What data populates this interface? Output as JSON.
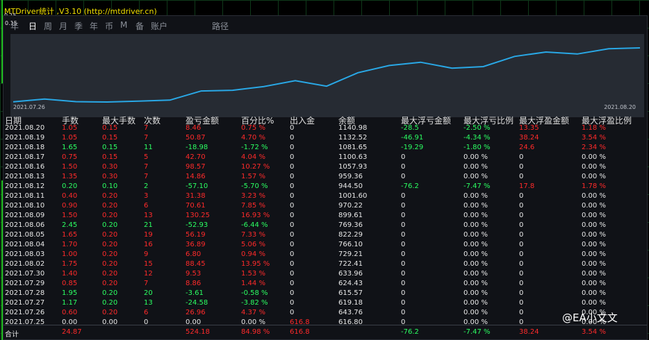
{
  "title": "MTDriver统计 ,V3.10 (http://mtdriver.cn)",
  "price_top": "0.15",
  "price_low": "0.15",
  "tabs": [
    "年",
    "日",
    "周",
    "月",
    "季",
    "年",
    "币",
    "M",
    "备",
    "账户",
    "路径"
  ],
  "active_tab": 1,
  "chart_data": {
    "type": "line",
    "x_start": "2021.07.26",
    "x_end": "2021.08.20",
    "x": [
      "2021.07.25",
      "2021.07.26",
      "2021.07.27",
      "2021.07.28",
      "2021.07.29",
      "2021.07.30",
      "2021.08.02",
      "2021.08.03",
      "2021.08.04",
      "2021.08.05",
      "2021.08.06",
      "2021.08.09",
      "2021.08.10",
      "2021.08.11",
      "2021.08.12",
      "2021.08.13",
      "2021.08.16",
      "2021.08.17",
      "2021.08.18",
      "2021.08.19",
      "2021.08.20"
    ],
    "values": [
      616.8,
      643.76,
      619.18,
      615.57,
      624.43,
      633.96,
      722.41,
      729.21,
      766.1,
      822.29,
      769.36,
      899.61,
      970.22,
      1001.6,
      944.5,
      959.36,
      1057.93,
      1100.63,
      1081.65,
      1132.52,
      1140.98
    ],
    "color": "#29a8e6"
  },
  "headers": [
    "日期",
    "手数",
    "最大手数",
    "次数",
    "盈亏金额",
    "百分比%",
    "出入金",
    "余额",
    "最大浮亏金额",
    "最大浮亏比例",
    "最大浮盈金额",
    "最大浮盈比例"
  ],
  "rows": [
    {
      "c": [
        "2021.08.20",
        "1.05",
        "0.15",
        "7",
        "8.46",
        "0.75 %",
        "0",
        "1140.98",
        "-28.5",
        "-2.50 %",
        "13.35",
        "1.18 %"
      ],
      "k": "r"
    },
    {
      "c": [
        "2021.08.19",
        "1.05",
        "0.15",
        "7",
        "50.87",
        "4.70 %",
        "0",
        "1132.52",
        "-46.91",
        "-4.34 %",
        "38.24",
        "3.54 %"
      ],
      "k": "r"
    },
    {
      "c": [
        "2021.08.18",
        "1.65",
        "0.15",
        "11",
        "-18.98",
        "-1.72 %",
        "0",
        "1081.65",
        "-19.29",
        "-1.80 %",
        "24.6",
        "2.34 %"
      ],
      "k": "g"
    },
    {
      "c": [
        "2021.08.17",
        "0.75",
        "0.15",
        "5",
        "42.70",
        "4.04 %",
        "0",
        "1100.63",
        "0",
        "0.00 %",
        "0",
        "0.00 %"
      ],
      "k": "r"
    },
    {
      "c": [
        "2021.08.16",
        "1.50",
        "0.30",
        "7",
        "98.57",
        "10.27 %",
        "0",
        "1057.93",
        "0",
        "0.00 %",
        "0",
        "0.00 %"
      ],
      "k": "r"
    },
    {
      "c": [
        "2021.08.13",
        "1.35",
        "0.30",
        "7",
        "14.86",
        "1.57 %",
        "0",
        "959.36",
        "0",
        "0.00 %",
        "0",
        "0.00 %"
      ],
      "k": "r"
    },
    {
      "c": [
        "2021.08.12",
        "0.20",
        "0.10",
        "2",
        "-57.10",
        "-5.70 %",
        "0",
        "944.50",
        "-76.2",
        "-7.47 %",
        "17.8",
        "1.78 %"
      ],
      "k": "g"
    },
    {
      "c": [
        "2021.08.11",
        "0.40",
        "0.20",
        "3",
        "31.38",
        "3.23 %",
        "0",
        "1001.60",
        "0",
        "0.00 %",
        "0",
        "0.00 %"
      ],
      "k": "r"
    },
    {
      "c": [
        "2021.08.10",
        "0.90",
        "0.20",
        "6",
        "70.61",
        "7.85 %",
        "0",
        "970.22",
        "0",
        "0.00 %",
        "0",
        "0.00 %"
      ],
      "k": "r"
    },
    {
      "c": [
        "2021.08.09",
        "1.50",
        "0.20",
        "13",
        "130.25",
        "16.93 %",
        "0",
        "899.61",
        "0",
        "0.00 %",
        "0",
        "0.00 %"
      ],
      "k": "r"
    },
    {
      "c": [
        "2021.08.06",
        "2.45",
        "0.20",
        "21",
        "-52.93",
        "-6.44 %",
        "0",
        "769.36",
        "0",
        "0.00 %",
        "0",
        "0.00 %"
      ],
      "k": "g"
    },
    {
      "c": [
        "2021.08.05",
        "1.65",
        "0.20",
        "19",
        "56.19",
        "7.33 %",
        "0",
        "822.29",
        "0",
        "0.00 %",
        "0",
        "0.00 %"
      ],
      "k": "r"
    },
    {
      "c": [
        "2021.08.04",
        "1.70",
        "0.20",
        "16",
        "36.89",
        "5.06 %",
        "0",
        "766.10",
        "0",
        "0.00 %",
        "0",
        "0.00 %"
      ],
      "k": "r"
    },
    {
      "c": [
        "2021.08.03",
        "1.00",
        "0.20",
        "9",
        "6.80",
        "0.94 %",
        "0",
        "729.21",
        "0",
        "0.00 %",
        "0",
        "0.00 %"
      ],
      "k": "r"
    },
    {
      "c": [
        "2021.08.02",
        "1.75",
        "0.20",
        "15",
        "88.45",
        "13.95 %",
        "0",
        "722.41",
        "0",
        "0.00 %",
        "0",
        "0.00 %"
      ],
      "k": "r"
    },
    {
      "c": [
        "2021.07.30",
        "1.40",
        "0.20",
        "12",
        "9.53",
        "1.53 %",
        "0",
        "633.96",
        "0",
        "0.00 %",
        "0",
        "0.00 %"
      ],
      "k": "r"
    },
    {
      "c": [
        "2021.07.29",
        "0.85",
        "0.20",
        "7",
        "8.86",
        "1.44 %",
        "0",
        "624.43",
        "0",
        "0.00 %",
        "0",
        "0.00 %"
      ],
      "k": "r"
    },
    {
      "c": [
        "2021.07.28",
        "1.95",
        "0.20",
        "20",
        "-3.61",
        "-0.58 %",
        "0",
        "615.57",
        "0",
        "0.00 %",
        "0",
        "0.00 %"
      ],
      "k": "g"
    },
    {
      "c": [
        "2021.07.27",
        "1.17",
        "0.20",
        "13",
        "-24.58",
        "-3.82 %",
        "0",
        "619.18",
        "0",
        "0.00 %",
        "0",
        "0.00 %"
      ],
      "k": "g"
    },
    {
      "c": [
        "2021.07.26",
        "0.60",
        "0.20",
        "6",
        "26.96",
        "4.37 %",
        "0",
        "643.76",
        "0",
        "0.00 %",
        "0",
        "0.00 %"
      ],
      "k": "r"
    },
    {
      "c": [
        "2021.07.25",
        "0.00",
        "0.00",
        "0",
        "0.00",
        "0.00 %",
        "616.8",
        "616.80",
        "0",
        "0.00 %",
        "0",
        "0.00 %"
      ],
      "k": "w"
    }
  ],
  "totals": [
    "合计",
    "24.87",
    "",
    "",
    "524.18",
    "84.98 %",
    "616.8",
    "",
    "-76.2",
    "-7.47 %",
    "38.24",
    "3.54 %"
  ],
  "watermark": "@EA小文文"
}
